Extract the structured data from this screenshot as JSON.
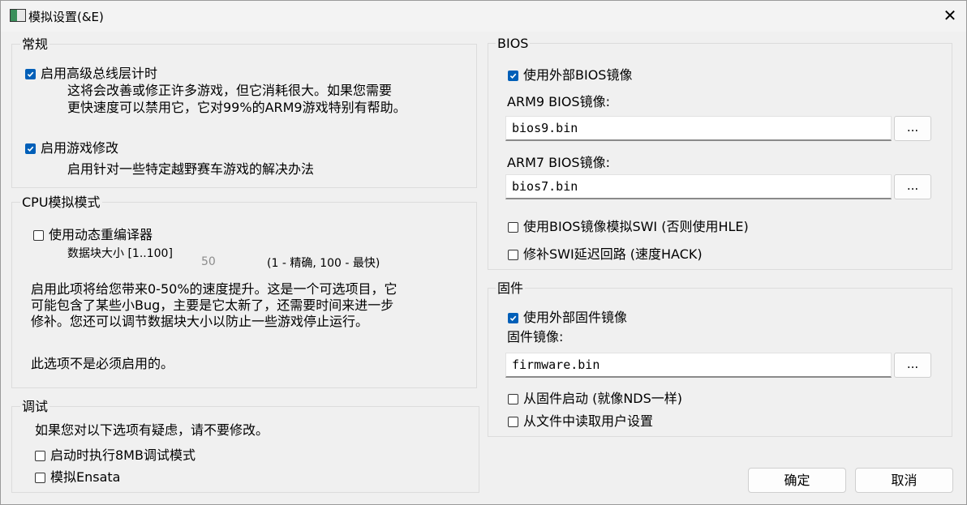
{
  "window": {
    "title": "模拟设置(&E)",
    "close": "✕"
  },
  "general": {
    "label": "常规",
    "bus_timing": {
      "label": "启用高级总线层计时",
      "checked": true,
      "desc1": "这将会改善或修正许多游戏，但它消耗很大。如果您需要",
      "desc2": "更快速度可以禁用它，它对99%的ARM9游戏特别有帮助。"
    },
    "game_hacks": {
      "label": "启用游戏修改",
      "checked": true,
      "desc": "启用针对一些特定越野赛车游戏的解决办法"
    }
  },
  "cpu": {
    "label": "CPU模拟模式",
    "dynarec": {
      "label": "使用动态重编译器",
      "checked": false
    },
    "block_size_label": "数据块大小 [1..100]",
    "block_size_value": "50",
    "block_size_hint": "(1 - 精确, 100 - 最快)",
    "desc1": "启用此项将给您带来0-50%的速度提升。这是一个可选项目，它",
    "desc2": "可能包含了某些小Bug，主要是它太新了，还需要时间来进一步",
    "desc3": "修补。您还可以调节数据块大小以防止一些游戏停止运行。",
    "desc4": "此选项不是必须启用的。"
  },
  "debug": {
    "label": "调试",
    "warning": "如果您对以下选项有疑虑，请不要修改。",
    "debug8mb": {
      "label": "启动时执行8MB调试模式",
      "checked": false
    },
    "ensata": {
      "label": "模拟Ensata",
      "checked": false
    }
  },
  "bios": {
    "label": "BIOS",
    "use_external": {
      "label": "使用外部BIOS镜像",
      "checked": true
    },
    "arm9_label": "ARM9 BIOS镜像:",
    "arm9_value": "bios9.bin",
    "arm7_label": "ARM7 BIOS镜像:",
    "arm7_value": "bios7.bin",
    "browse": "...",
    "swi": {
      "label": "使用BIOS镜像模拟SWI (否则使用HLE)",
      "checked": false
    },
    "swi_patch": {
      "label": "修补SWI延迟回路 (速度HACK)",
      "checked": false
    }
  },
  "firmware": {
    "label": "固件",
    "use_external": {
      "label": "使用外部固件镜像",
      "checked": true
    },
    "image_label": "固件镜像:",
    "image_value": "firmware.bin",
    "browse": "...",
    "boot": {
      "label": "从固件启动 (就像NDS一样)",
      "checked": false
    },
    "user_settings": {
      "label": "从文件中读取用户设置",
      "checked": false
    }
  },
  "buttons": {
    "ok": "确定",
    "cancel": "取消"
  },
  "colors": {
    "accent": "#005fb8",
    "background": "#f0f0f0"
  }
}
